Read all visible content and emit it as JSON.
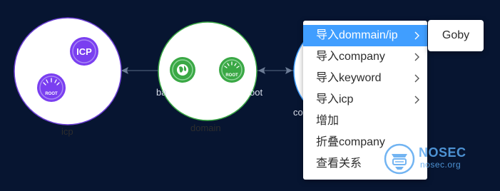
{
  "graph": {
    "nodes": [
      {
        "id": "icp",
        "label": "icp",
        "child_badges": [
          {
            "icon": "icp-badge-icon",
            "text": "ICP"
          },
          {
            "icon": "root-badge-icon",
            "text": "ROOT"
          }
        ]
      },
      {
        "id": "domain",
        "label": "domain",
        "child_badges": [
          {
            "icon": "globe-badge-icon",
            "text": ""
          },
          {
            "icon": "root-badge-icon",
            "text": "ROOT"
          }
        ],
        "partial_labels": {
          "left": "ba",
          "right": "oot"
        }
      },
      {
        "id": "company",
        "label": "co",
        "partial": true
      }
    ],
    "colors": {
      "background": "#071531",
      "node_fill": "#ffffff",
      "icp_border": "#6d3fd6",
      "domain_border": "#3aa845",
      "company_border": "#409eff",
      "badge_purple": "#7a3ff0",
      "badge_green": "#3aa845"
    }
  },
  "context_menu": {
    "items": [
      {
        "label": "导入dommain/ip",
        "has_submenu": true,
        "active": true
      },
      {
        "label": "导入company",
        "has_submenu": true,
        "active": false
      },
      {
        "label": "导入keyword",
        "has_submenu": true,
        "active": false
      },
      {
        "label": "导入icp",
        "has_submenu": true,
        "active": false
      },
      {
        "label": "增加",
        "has_submenu": false,
        "active": false
      },
      {
        "label": "折叠company",
        "has_submenu": false,
        "active": false
      },
      {
        "label": "查看关系",
        "has_submenu": false,
        "active": false
      }
    ],
    "accent_color": "#409eff"
  },
  "submenu": {
    "items": [
      {
        "label": "Goby"
      }
    ]
  },
  "watermark": {
    "title": "NOSEC",
    "subtitle": "nosec.org"
  }
}
